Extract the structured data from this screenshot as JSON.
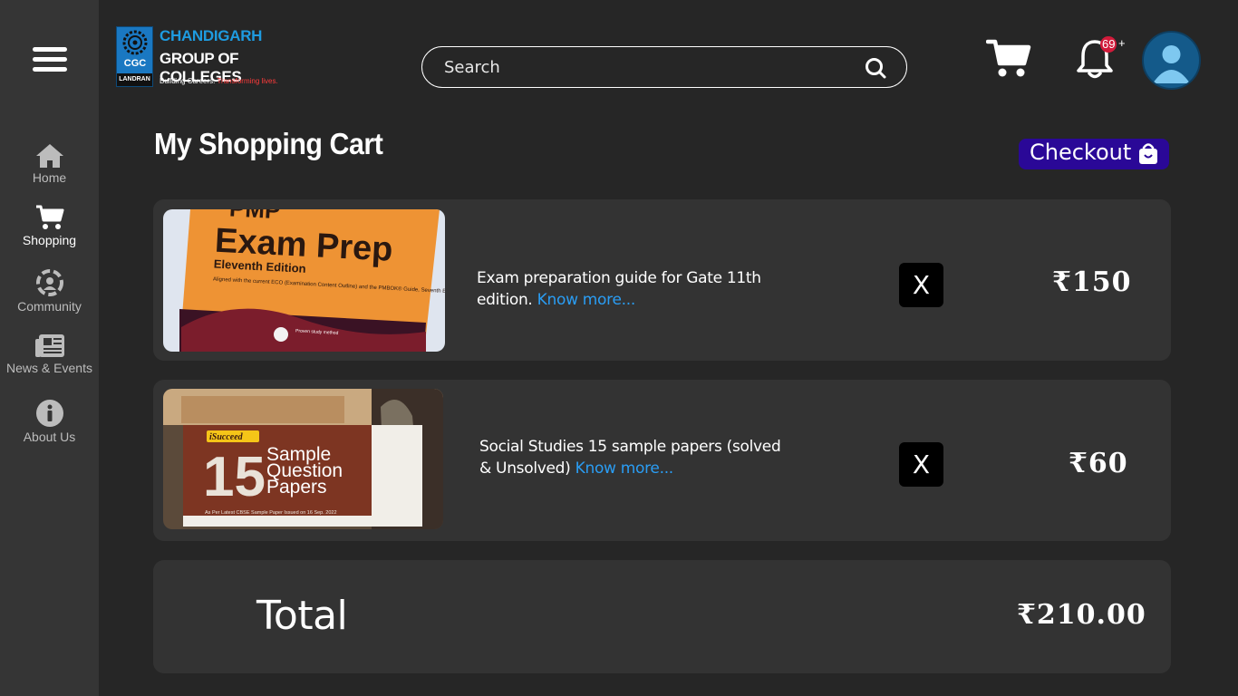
{
  "brand": {
    "mark": "CGC",
    "mark_sub": "LANDRAN",
    "line1": "CHANDIGARH",
    "line2": "GROUP OF COLLEGES",
    "tagline_white": "Building Careers.",
    "tagline_red": "Transforming lives."
  },
  "search": {
    "placeholder": "Search"
  },
  "notifications": {
    "count": "69",
    "suffix": "+"
  },
  "sidebar": {
    "items": [
      {
        "label": "Home",
        "icon": "home-icon"
      },
      {
        "label": "Shopping",
        "icon": "cart-icon"
      },
      {
        "label": "Community",
        "icon": "community-icon"
      },
      {
        "label": "News & Events",
        "icon": "newspaper-icon"
      },
      {
        "label": "About Us",
        "icon": "info-icon"
      }
    ]
  },
  "page": {
    "title": "My Shopping Cart",
    "checkout_label": "Checkout"
  },
  "cart": {
    "items": [
      {
        "image_text": [
          "PMP",
          "Exam Prep",
          "Eleventh Edition",
          "Aligned with the current ECO (Examination Content Outline) and the PMBOK® Guide, Seventh Edition",
          "Proven study method"
        ],
        "description": "Exam preparation guide for Gate 11th edition.",
        "link": "Know more...",
        "remove_label": "X",
        "price": "₹150"
      },
      {
        "image_text": [
          "iSucceed",
          "15",
          "Sample",
          "Question",
          "Papers",
          "As Per Latest CBSE Sample Paper Issued on 16 Sep. 2022"
        ],
        "description": "Social Studies 15 sample papers (solved & Unsolved)",
        "link": "Know more...",
        "remove_label": "X",
        "price": "₹60"
      }
    ],
    "total_label": "Total",
    "total_value": "₹210.00"
  },
  "colors": {
    "background": "#262626",
    "sidebar": "#353535",
    "card": "#333333",
    "checkout": "#2a0897",
    "link": "#2a9df4",
    "badge": "#d11a3a",
    "brand_blue": "#1e9be0"
  }
}
